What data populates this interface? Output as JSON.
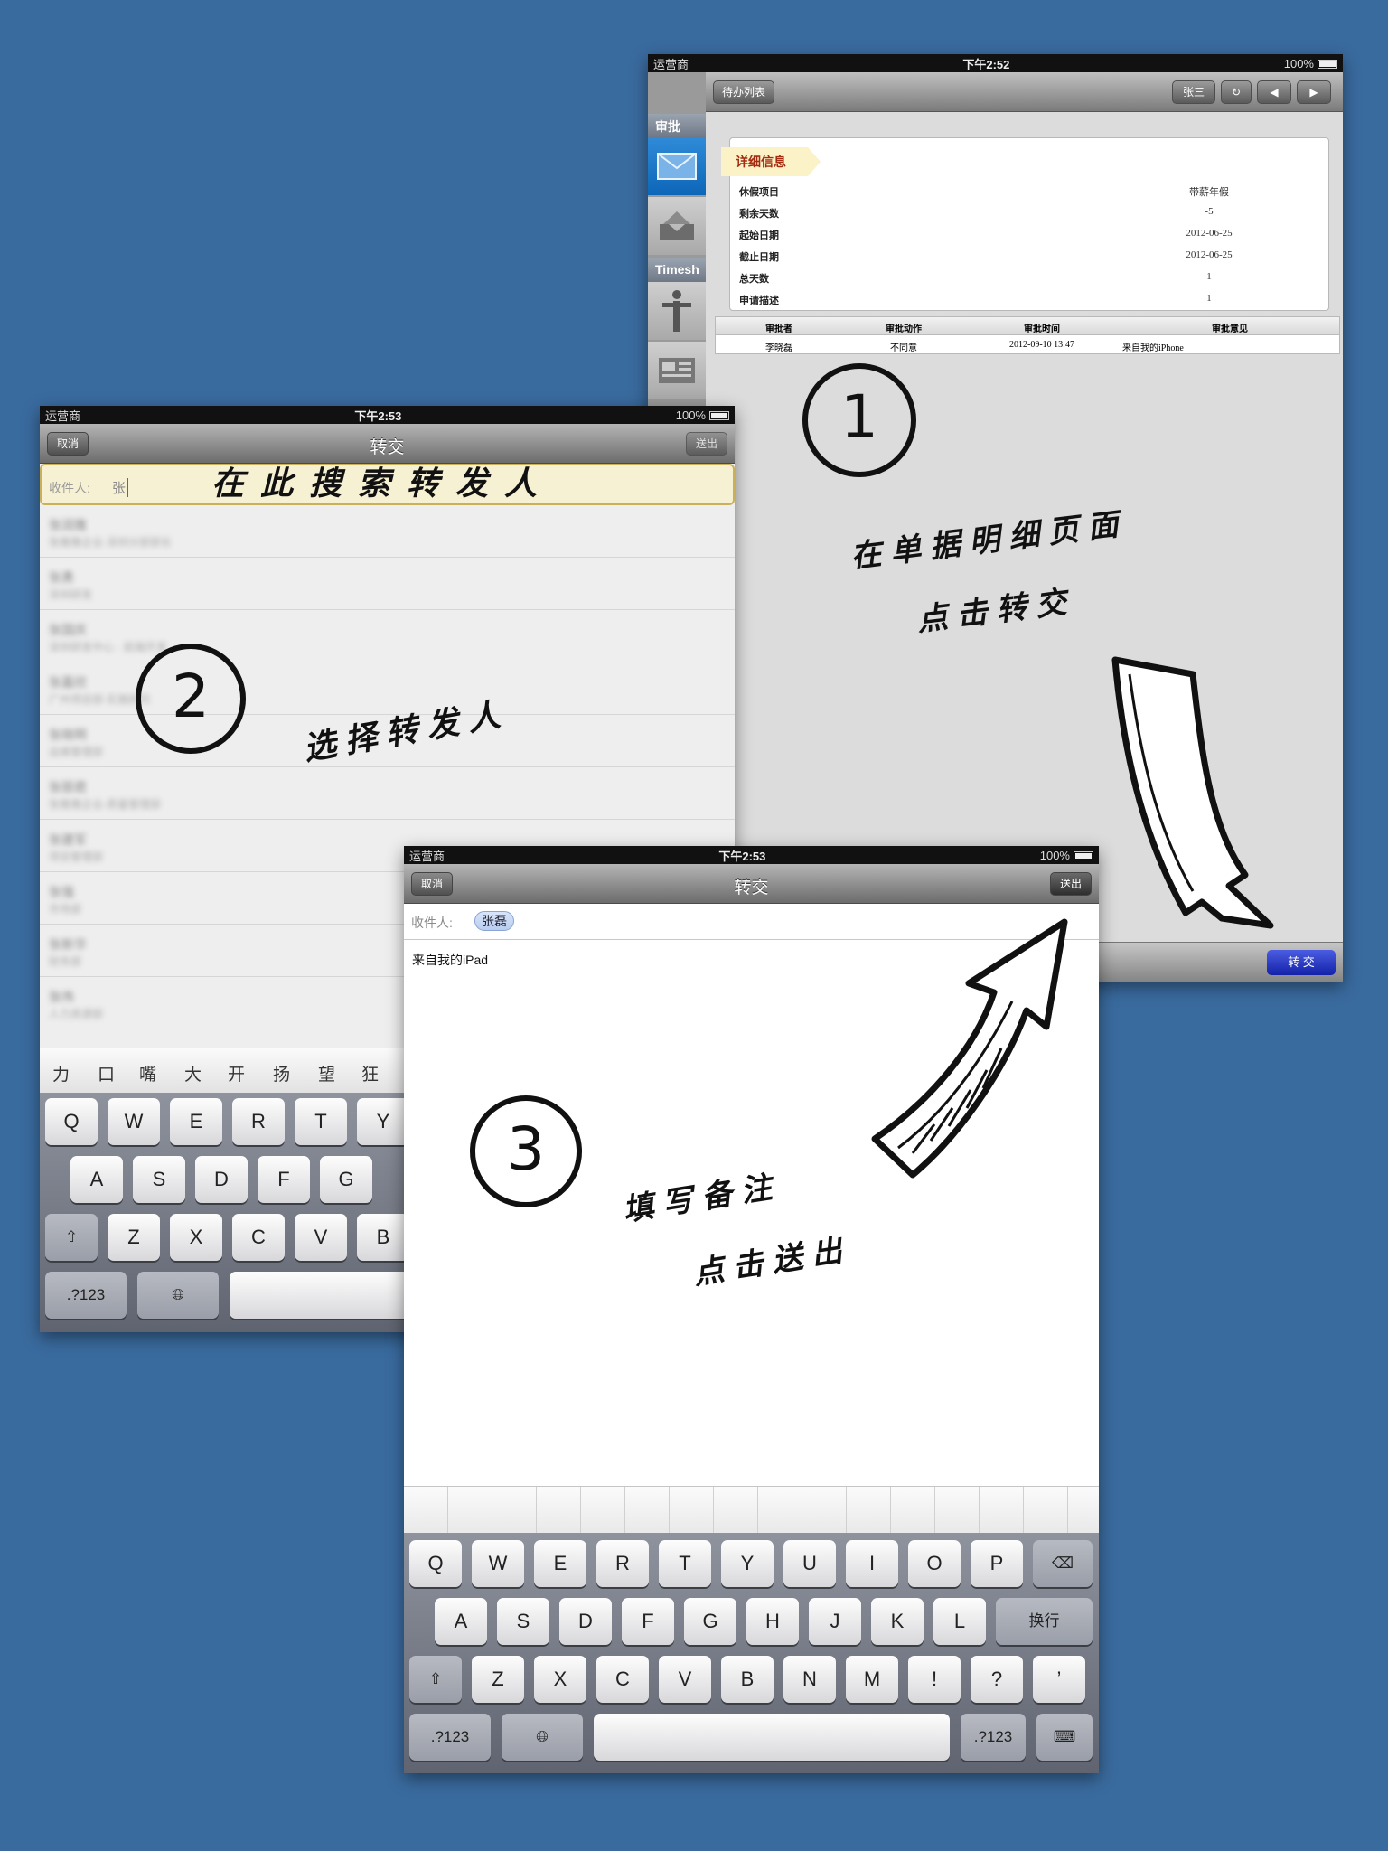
{
  "screen1": {
    "status": {
      "carrier": "运营商",
      "time": "下午2:52",
      "battery": "100%"
    },
    "sidebar": {
      "section1": "审批",
      "section2": "Timesh"
    },
    "topbar": {
      "back": "待办列表",
      "user": "张三"
    },
    "detail": {
      "ribbon": "详细信息",
      "rows": [
        {
          "label": "休假项目",
          "value": "带薪年假"
        },
        {
          "label": "剩余天数",
          "value": "-5"
        },
        {
          "label": "起始日期",
          "value": "2012-06-25"
        },
        {
          "label": "截止日期",
          "value": "2012-06-25"
        },
        {
          "label": "总天数",
          "value": "1"
        },
        {
          "label": "申请描述",
          "value": "1"
        }
      ]
    },
    "approval": {
      "headers": [
        "审批者",
        "审批动作",
        "审批时间",
        "审批意见"
      ],
      "row": [
        "李晓磊",
        "不同意",
        "2012-09-10 13:47",
        "来自我的iPhone"
      ]
    },
    "transfer_button": "转 交"
  },
  "screen2": {
    "status": {
      "carrier": "运营商",
      "time": "下午2:53",
      "battery": "100%"
    },
    "nav": {
      "title": "转交",
      "cancel": "取消",
      "send": "送出"
    },
    "search": {
      "label": "收件人:",
      "value": "张"
    },
    "results": [
      {
        "name": "张润雅",
        "detail": "张雅雅企业-深圳分部部长"
      },
      {
        "name": "张勇",
        "detail": "深圳研发"
      },
      {
        "name": "张国庆",
        "detail": "深圳研发中心 · 前端开发"
      },
      {
        "name": "张嘉欣",
        "detail": "广州项目部-实施顾问"
      },
      {
        "name": "张晓明",
        "detail": "运维管理部"
      },
      {
        "name": "张丽君",
        "detail": "张雅雅企业-质量管理部"
      },
      {
        "name": "张建军",
        "detail": "项目管理部"
      },
      {
        "name": "张强",
        "detail": "市场部"
      },
      {
        "name": "张新华",
        "detail": "财务部"
      },
      {
        "name": "张伟",
        "detail": "人力资源部"
      }
    ],
    "candidates": [
      "力",
      "口",
      "嘴",
      "大",
      "开",
      "扬",
      "望",
      "狂"
    ],
    "keyboard": {
      "row1": [
        "Q",
        "W",
        "E",
        "R",
        "T",
        "Y"
      ],
      "row2": [
        "A",
        "S",
        "D",
        "F",
        "G"
      ],
      "row3": [
        "Z",
        "X",
        "C",
        "V",
        "B"
      ],
      "numkey": ".?123"
    }
  },
  "screen3": {
    "status": {
      "carrier": "运营商",
      "time": "下午2:53",
      "battery": "100%"
    },
    "nav": {
      "title": "转交",
      "cancel": "取消",
      "send": "送出"
    },
    "recipient": {
      "label": "收件人:",
      "chip": "张磊"
    },
    "body": "来自我的iPad",
    "keyboard": {
      "row1": [
        "Q",
        "W",
        "E",
        "R",
        "T",
        "Y",
        "U",
        "I",
        "O",
        "P"
      ],
      "row2": [
        "A",
        "S",
        "D",
        "F",
        "G",
        "H",
        "J",
        "K",
        "L"
      ],
      "return": "换行",
      "row3": [
        "Z",
        "X",
        "C",
        "V",
        "B",
        "N",
        "M",
        "!",
        "?",
        "’"
      ],
      "numkey": ".?123"
    }
  },
  "annotations": {
    "step1": {
      "number": "1",
      "line1": "在单据明细页面",
      "line2": "点击转交"
    },
    "step2": {
      "number": "2",
      "text": "选择转发人",
      "search_hint": "在此搜索转发人"
    },
    "step3": {
      "number": "3",
      "line1": "填写备注",
      "line2": "点击送出"
    }
  },
  "colors": {
    "background": "#3a6b9f",
    "highlight": "#f7f1d3",
    "accent": "#1422a8"
  }
}
